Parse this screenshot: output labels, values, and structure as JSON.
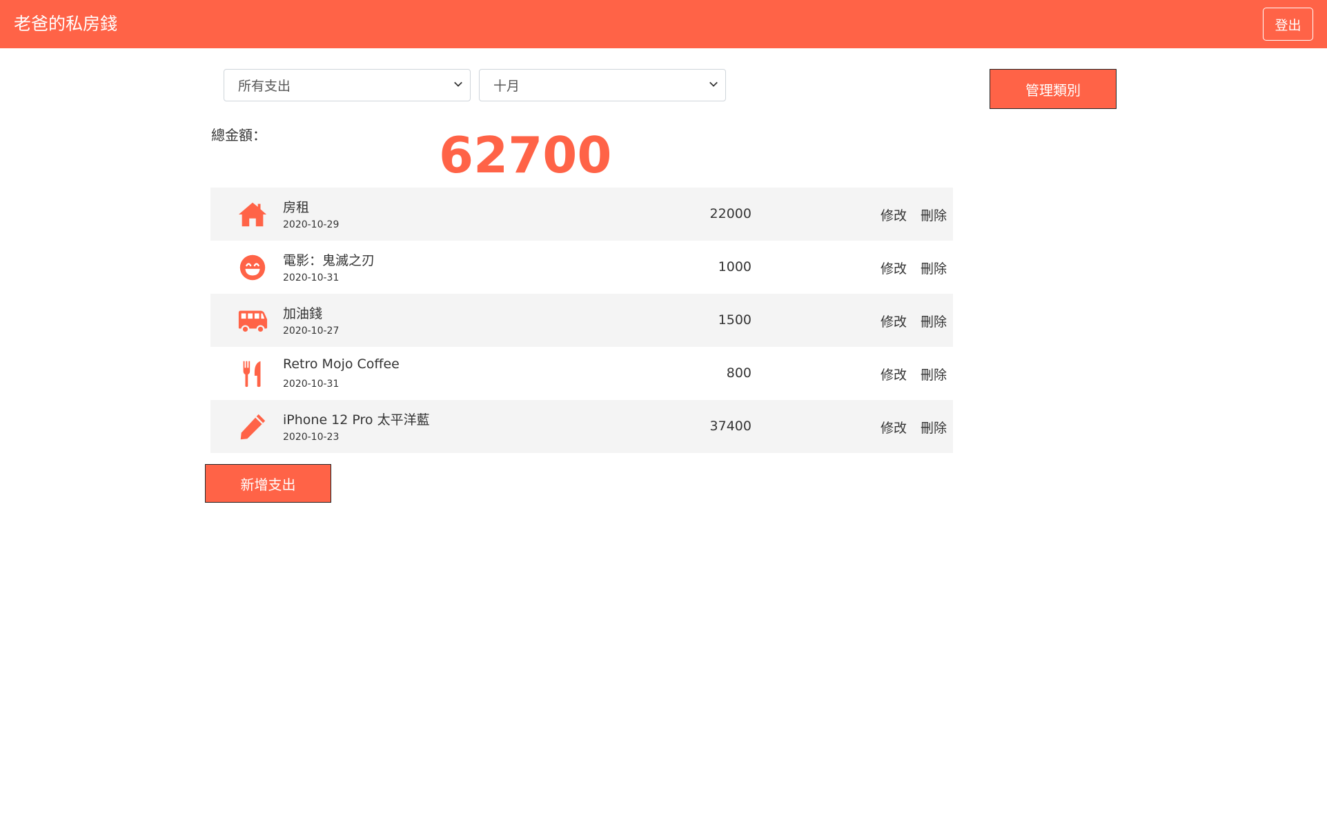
{
  "app": {
    "title": "老爸的私房錢",
    "logout_label": "登出"
  },
  "filters": {
    "category_selected": "所有支出",
    "month_selected": "十月"
  },
  "manage_label": "管理類別",
  "total": {
    "label": "總金額：",
    "amount": "62700"
  },
  "actions": {
    "edit": "修改",
    "delete": "刪除"
  },
  "records": [
    {
      "icon": "home-icon",
      "name": "房租",
      "date": "2020-10-29",
      "amount": "22000"
    },
    {
      "icon": "smile-icon",
      "name": "電影：鬼滅之刃",
      "date": "2020-10-31",
      "amount": "1000"
    },
    {
      "icon": "bus-icon",
      "name": "加油錢",
      "date": "2020-10-27",
      "amount": "1500"
    },
    {
      "icon": "utensils-icon",
      "name": "Retro Mojo Coffee",
      "date": "2020-10-31",
      "amount": "800"
    },
    {
      "icon": "pen-icon",
      "name": "iPhone 12 Pro 太平洋藍",
      "date": "2020-10-23",
      "amount": "37400"
    }
  ],
  "add_label": "新增支出",
  "colors": {
    "accent": "#ff6347",
    "row_shade": "#f4f4f4"
  }
}
